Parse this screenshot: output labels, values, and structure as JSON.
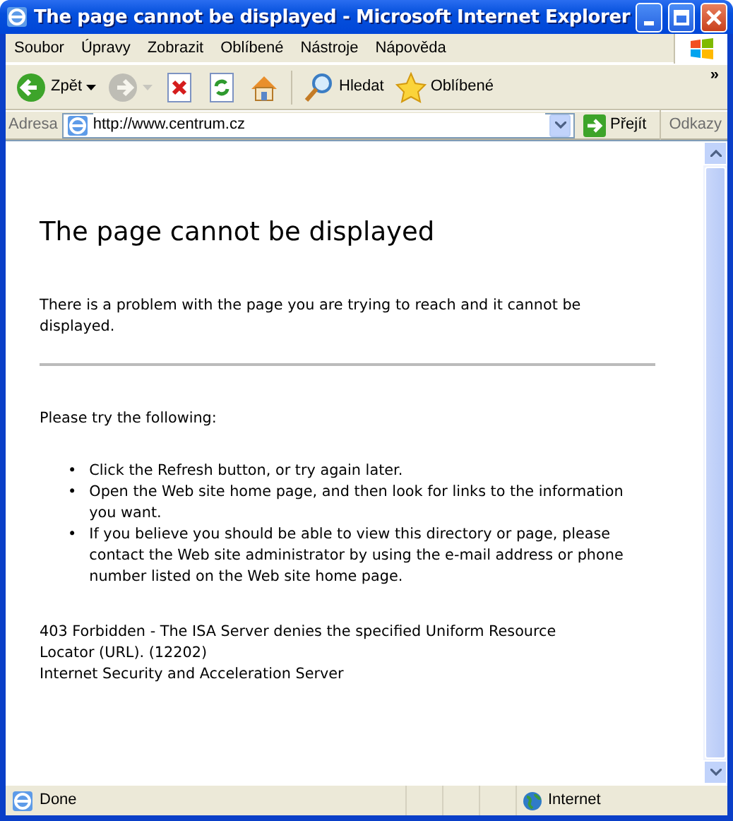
{
  "window": {
    "title": "The page cannot be displayed - Microsoft Internet Explorer"
  },
  "menu": [
    "Soubor",
    "Úpravy",
    "Zobrazit",
    "Oblíbené",
    "Nástroje",
    "Nápověda"
  ],
  "toolbar": [
    {
      "kind": "back",
      "label": "Zpět",
      "disabled": false,
      "dropdown": true
    },
    {
      "kind": "forward",
      "disabled": true,
      "dropdown": true
    },
    {
      "kind": "stop",
      "disabled": false
    },
    {
      "kind": "refresh",
      "disabled": false
    },
    {
      "kind": "home",
      "disabled": false
    },
    {
      "kind": "search",
      "label": "Hledat",
      "disabled": false
    },
    {
      "kind": "favorites",
      "label": "Oblíbené",
      "disabled": false
    }
  ],
  "toolbar_overflow": "»",
  "address": {
    "label": "Adresa",
    "value": "http://www.centrum.cz",
    "go": "Přejít",
    "links": "Odkazy"
  },
  "page": {
    "heading": "The page cannot be displayed",
    "intro": "There is a problem with the page you are trying to reach and it cannot be displayed.",
    "prompt": "Please try the following:",
    "tips": [
      {
        "bullet": "•",
        "text": "Click the Refresh button, or try again later."
      },
      {
        "bullet": "•",
        "text": "Open the Web site home page, and then look for links to the information you want."
      },
      {
        "bullet": "•",
        "text": "If you believe you should be able to view this directory or page, please contact the Web site administrator by using the e-mail address or phone number listed on the Web site home page."
      }
    ],
    "error": [
      "403 Forbidden - The ISA Server denies the specified Uniform Resource Locator (URL). (12202)",
      "Internet Security and Acceleration Server"
    ]
  },
  "status_bar": {
    "text": "Done",
    "zone": "Internet"
  }
}
